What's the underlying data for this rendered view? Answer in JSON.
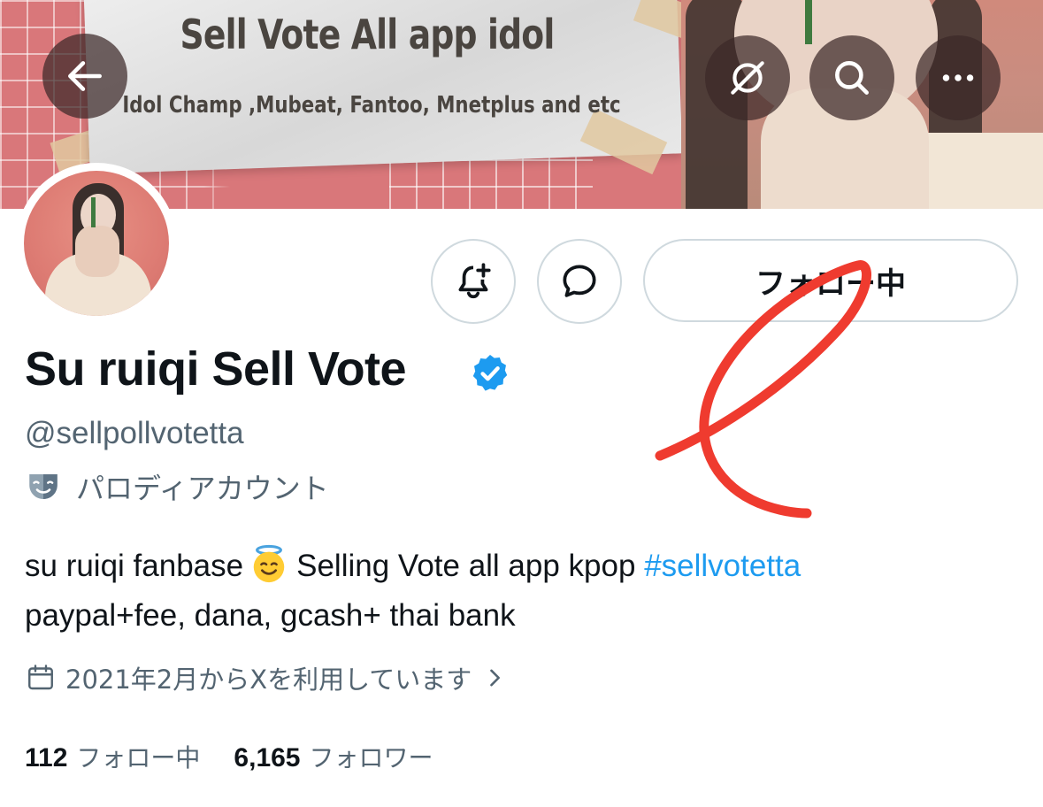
{
  "banner": {
    "title": "Sell Vote All app idol",
    "subtitle": "Idol Champ ,Mubeat, Fantoo, Mnetplus and etc"
  },
  "icons": {
    "back": "back-arrow-icon",
    "translate": "translate-off-icon",
    "search": "search-icon",
    "more": "more-icon",
    "bell": "notification-bell-plus-icon",
    "dm": "message-bubble-icon",
    "verified": "verified-badge-icon",
    "parody": "theater-mask-icon",
    "calendar": "calendar-icon",
    "chevron": "chevron-right-icon"
  },
  "colors": {
    "accent": "#1d9bf0",
    "muted": "#536471",
    "text": "#0f1419",
    "border": "#cfd9de",
    "annotation": "#ef3b2f"
  },
  "actions": {
    "following_label": "フォロー中"
  },
  "profile": {
    "display_name": "Su ruiqi Sell Vote",
    "handle": "@sellpollvotetta",
    "parody_label": "パロディアカウント",
    "bio": {
      "line1_before": "su ruiqi fanbase",
      "line1_after": "Selling Vote all app kpop",
      "hashtag": "#sellvotetta",
      "line2": "paypal+fee, dana, gcash+ thai bank"
    },
    "joined": "2021年2月からXを利用しています"
  },
  "stats": {
    "following_count": "112",
    "following_label": "フォロー中",
    "followers_count": "6,165",
    "followers_label": "フォロワー"
  }
}
